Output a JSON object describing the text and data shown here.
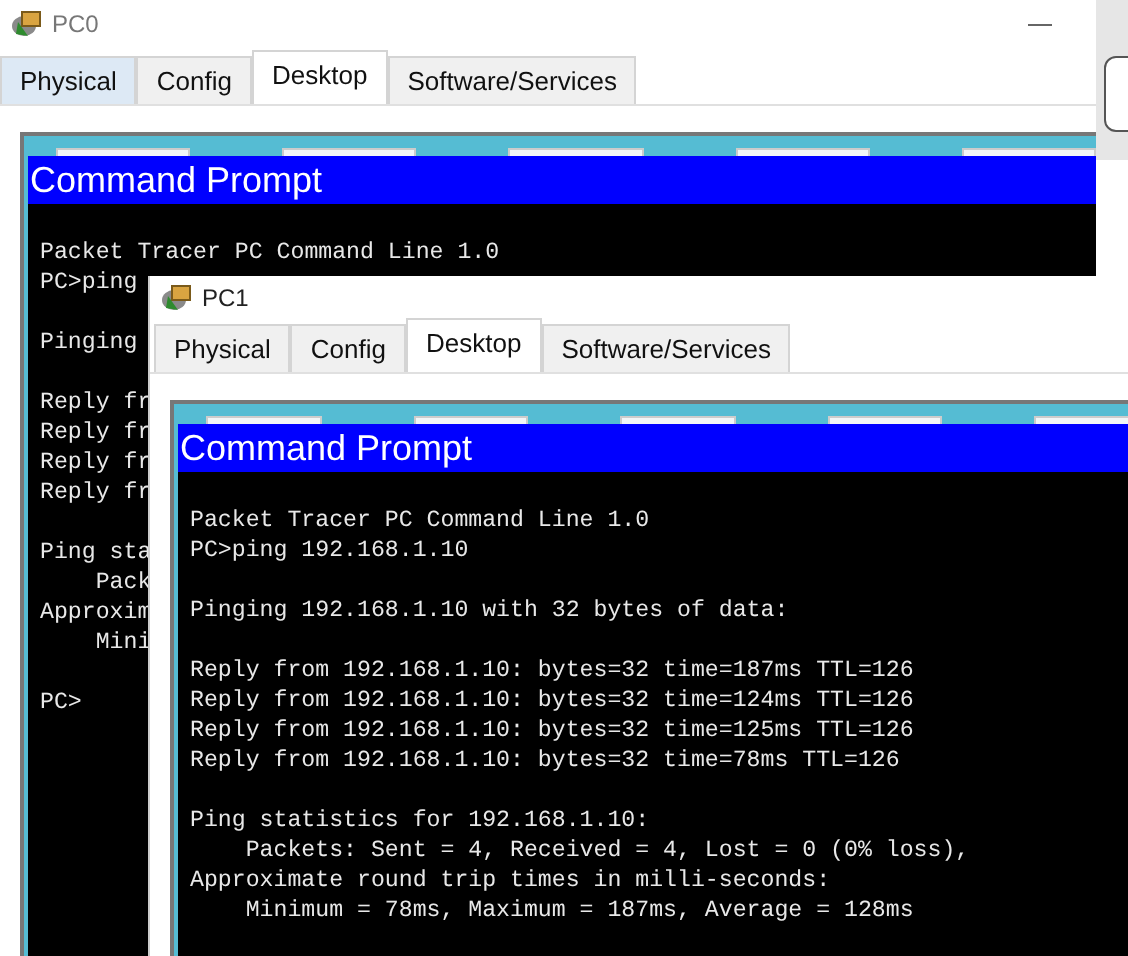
{
  "windows": [
    {
      "title": "PC0",
      "tabs": [
        {
          "label": "Physical",
          "selected": false,
          "hovered": true
        },
        {
          "label": "Config",
          "selected": false,
          "hovered": false
        },
        {
          "label": "Desktop",
          "selected": true,
          "hovered": false
        },
        {
          "label": "Software/Services",
          "selected": false,
          "hovered": false
        }
      ],
      "panel_title": "Command Prompt",
      "blocks": [
        [
          "Packet Tracer PC Command Line 1.0",
          "PC>ping"
        ],
        [
          "Pinging"
        ],
        [
          "Reply fr",
          "Reply fr",
          "Reply fr",
          "Reply fr"
        ],
        [
          "Ping sta",
          "    Pack",
          "Approxim",
          "    Mini"
        ],
        [
          "PC>"
        ]
      ]
    },
    {
      "title": "PC1",
      "tabs": [
        {
          "label": "Physical",
          "selected": false,
          "hovered": false
        },
        {
          "label": "Config",
          "selected": false,
          "hovered": false
        },
        {
          "label": "Desktop",
          "selected": true,
          "hovered": false
        },
        {
          "label": "Software/Services",
          "selected": false,
          "hovered": false
        }
      ],
      "panel_title": "Command Prompt",
      "blocks": [
        [
          "Packet Tracer PC Command Line 1.0",
          "PC>ping 192.168.1.10"
        ],
        [
          "Pinging 192.168.1.10 with 32 bytes of data:"
        ],
        [
          "Reply from 192.168.1.10: bytes=32 time=187ms TTL=126",
          "Reply from 192.168.1.10: bytes=32 time=124ms TTL=126",
          "Reply from 192.168.1.10: bytes=32 time=125ms TTL=126",
          "Reply from 192.168.1.10: bytes=32 time=78ms TTL=126"
        ],
        [
          "Ping statistics for 192.168.1.10:",
          "    Packets: Sent = 4, Received = 4, Lost = 0 (0% loss),",
          "Approximate round trip times in milli-seconds:",
          "    Minimum = 78ms, Maximum = 187ms, Average = 128ms"
        ]
      ]
    }
  ]
}
